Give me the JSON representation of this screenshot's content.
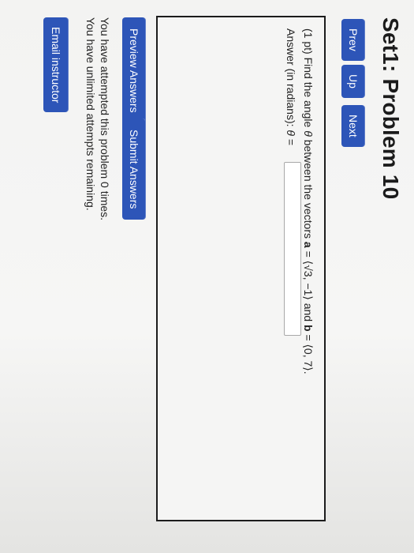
{
  "page": {
    "title": "Set1: Problem 10"
  },
  "nav": {
    "prev_label": "Prev",
    "up_label": "Up",
    "next_label": "Next"
  },
  "problem": {
    "points": "(1 pt)",
    "question_prefix": "Find the angle",
    "theta_symbol": "θ",
    "question_middle": "between the vectors",
    "vector_a_name": "a",
    "vector_a_value": "⟨√3, −1⟩",
    "and_word": "and",
    "vector_b_name": "b",
    "vector_b_value": "⟨0, 7⟩.",
    "answer_label": "Answer (in radians):",
    "answer_var": "θ",
    "equals": "=",
    "answer_value": ""
  },
  "actions": {
    "preview_label": "Preview Answers",
    "submit_label": "Submit Answers"
  },
  "status": {
    "attempts_msg": "You have attempted this problem 0 times.",
    "remaining_msg": "You have unlimited attempts remaining."
  },
  "footer": {
    "email_label": "Email instructor"
  },
  "colors": {
    "button_blue": "#2d55b8",
    "border_dark": "#1c1c1c"
  }
}
